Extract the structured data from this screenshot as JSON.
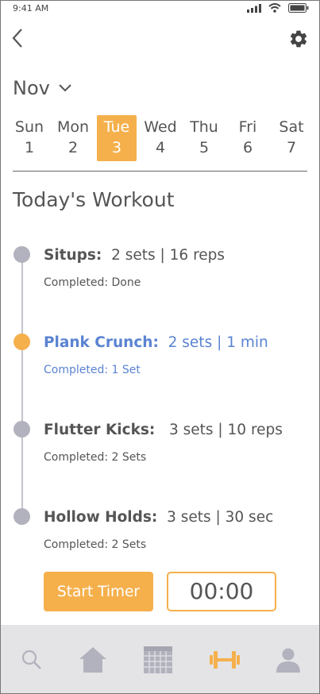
{
  "status_bar": {
    "time": "9:41 AM"
  },
  "header": {
    "back_icon": "chevron-left-icon",
    "settings_icon": "gear-icon"
  },
  "calendar": {
    "month": "Nov",
    "days": [
      {
        "name": "Sun",
        "num": "1"
      },
      {
        "name": "Mon",
        "num": "2"
      },
      {
        "name": "Tue",
        "num": "3"
      },
      {
        "name": "Wed",
        "num": "4"
      },
      {
        "name": "Thu",
        "num": "5"
      },
      {
        "name": "Fri",
        "num": "6"
      },
      {
        "name": "Sat",
        "num": "7"
      }
    ],
    "selected_day": "Tue"
  },
  "workout": {
    "title": "Today's Workout",
    "exercises": [
      {
        "name": "Situps:",
        "detail": "2 sets | 16 reps",
        "status": "Completed: Done"
      },
      {
        "name": "Plank Crunch:",
        "detail": "2 sets | 1 min",
        "status": "Completed: 1 Set"
      },
      {
        "name": "Flutter Kicks:",
        "detail": "3 sets | 10 reps",
        "status": "Completed: 2 Sets"
      },
      {
        "name": "Hollow Holds:",
        "detail": "3 sets | 30 sec",
        "status": "Completed: 2 Sets"
      }
    ],
    "active_exercise": "Plank Crunch:"
  },
  "timer": {
    "button_label": "Start Timer",
    "display": "00:00"
  },
  "tab_bar": {
    "tabs": [
      "search-icon",
      "home-icon",
      "calendar-icon",
      "dumbbell-icon",
      "profile-icon"
    ],
    "active_tab": "dumbbell-icon"
  },
  "colors": {
    "accent": "#f5b04c",
    "active_text": "#5a83d2",
    "inactive_dot": "#b1b2bd",
    "tab_bar_bg": "#e4e4e6"
  }
}
